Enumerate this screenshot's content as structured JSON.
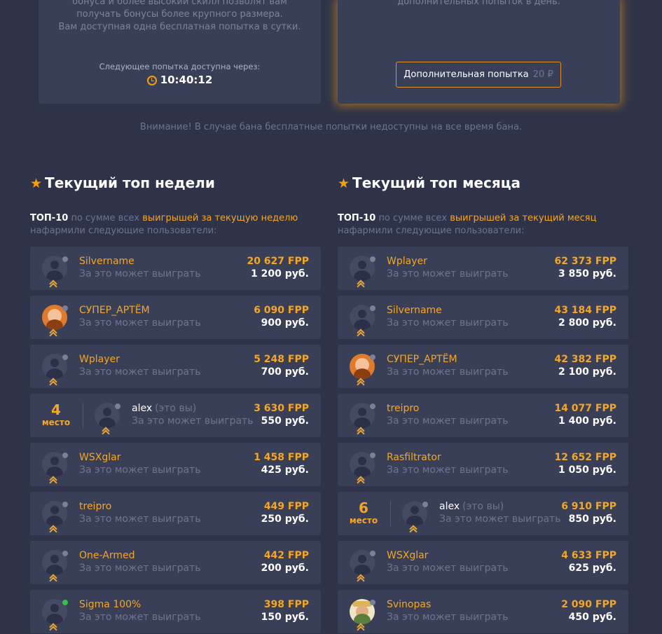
{
  "bonus_card": {
    "desc_lines": [
      "бонуса и более высокий скилл позволят вам",
      "получать бонусы более крупного размера.",
      "Вам доступная одна бесплатная попытка в сутки."
    ],
    "next_label": "Следующее попытка доступна через:",
    "timer": "10:40:12",
    "timer_icon": "alarm-clock-icon"
  },
  "extra_card": {
    "desc": "дополнительных попыток в день.",
    "button_label": "Дополнительная попытка",
    "button_price": "20 ₽"
  },
  "warning": "Внимание! В случае бана бесплатные попытки недоступны на все время бана.",
  "weekly": {
    "title": "Текущий топ недели",
    "sub_bold": "ТОП-10",
    "sub_mid": "по сумме всех",
    "sub_hl": "выигрышей за текущую неделю",
    "sub_tail": "нафармили следующие пользователи:",
    "rows": [
      {
        "name": "Silvername",
        "note": "За это может выиграть",
        "fpp": "20 627 FPP",
        "rub": "1 200 руб."
      },
      {
        "name": "СУПЕР_АРТЁМ",
        "note": "За это может выиграть",
        "fpp": "6 090 FPP",
        "rub": "900 руб."
      },
      {
        "name": "Wplayer",
        "note": "За это может выиграть",
        "fpp": "5 248 FPP",
        "rub": "700 руб."
      },
      {
        "place": "4",
        "place_label": "место",
        "name": "alex",
        "you": "(это вы)",
        "note": "За это может выиграть",
        "fpp": "3 630 FPP",
        "rub": "550 руб."
      },
      {
        "name": "WSXglar",
        "note": "За это может выиграть",
        "fpp": "1 458 FPP",
        "rub": "425 руб."
      },
      {
        "name": "treipro",
        "note": "За это может выиграть",
        "fpp": "449 FPP",
        "rub": "250 руб."
      },
      {
        "name": "One-Armed",
        "note": "За это может выиграть",
        "fpp": "442 FPP",
        "rub": "200 руб."
      },
      {
        "name": "Sigma 100%",
        "note": "За это может выиграть",
        "fpp": "398 FPP",
        "rub": "150 руб."
      }
    ]
  },
  "monthly": {
    "title": "Текущий топ месяца",
    "sub_bold": "ТОП-10",
    "sub_mid": "по сумме всех",
    "sub_hl": "выигрышей за текущий месяц",
    "sub_tail": "нафармили следующие пользователи:",
    "rows": [
      {
        "name": "Wplayer",
        "note": "За это может выиграть",
        "fpp": "62 373 FPP",
        "rub": "3 850 руб."
      },
      {
        "name": "Silvername",
        "note": "За это может выиграть",
        "fpp": "43 184 FPP",
        "rub": "2 800 руб."
      },
      {
        "name": "СУПЕР_АРТЁМ",
        "note": "За это может выиграть",
        "fpp": "42 382 FPP",
        "rub": "2 100 руб."
      },
      {
        "name": "treipro",
        "note": "За это может выиграть",
        "fpp": "14 077 FPP",
        "rub": "1 400 руб."
      },
      {
        "name": "Rasfiltrator",
        "note": "За это может выиграть",
        "fpp": "12 652 FPP",
        "rub": "1 050 руб."
      },
      {
        "place": "6",
        "place_label": "место",
        "name": "alex",
        "you": "(это вы)",
        "note": "За это может выиграть",
        "fpp": "6 910 FPP",
        "rub": "850 руб."
      },
      {
        "name": "WSXglar",
        "note": "За это может выиграть",
        "fpp": "4 633 FPP",
        "rub": "625 руб."
      },
      {
        "name": "Svinopas",
        "note": "За это может выиграть",
        "fpp": "2 090 FPP",
        "rub": "450 руб."
      }
    ]
  }
}
